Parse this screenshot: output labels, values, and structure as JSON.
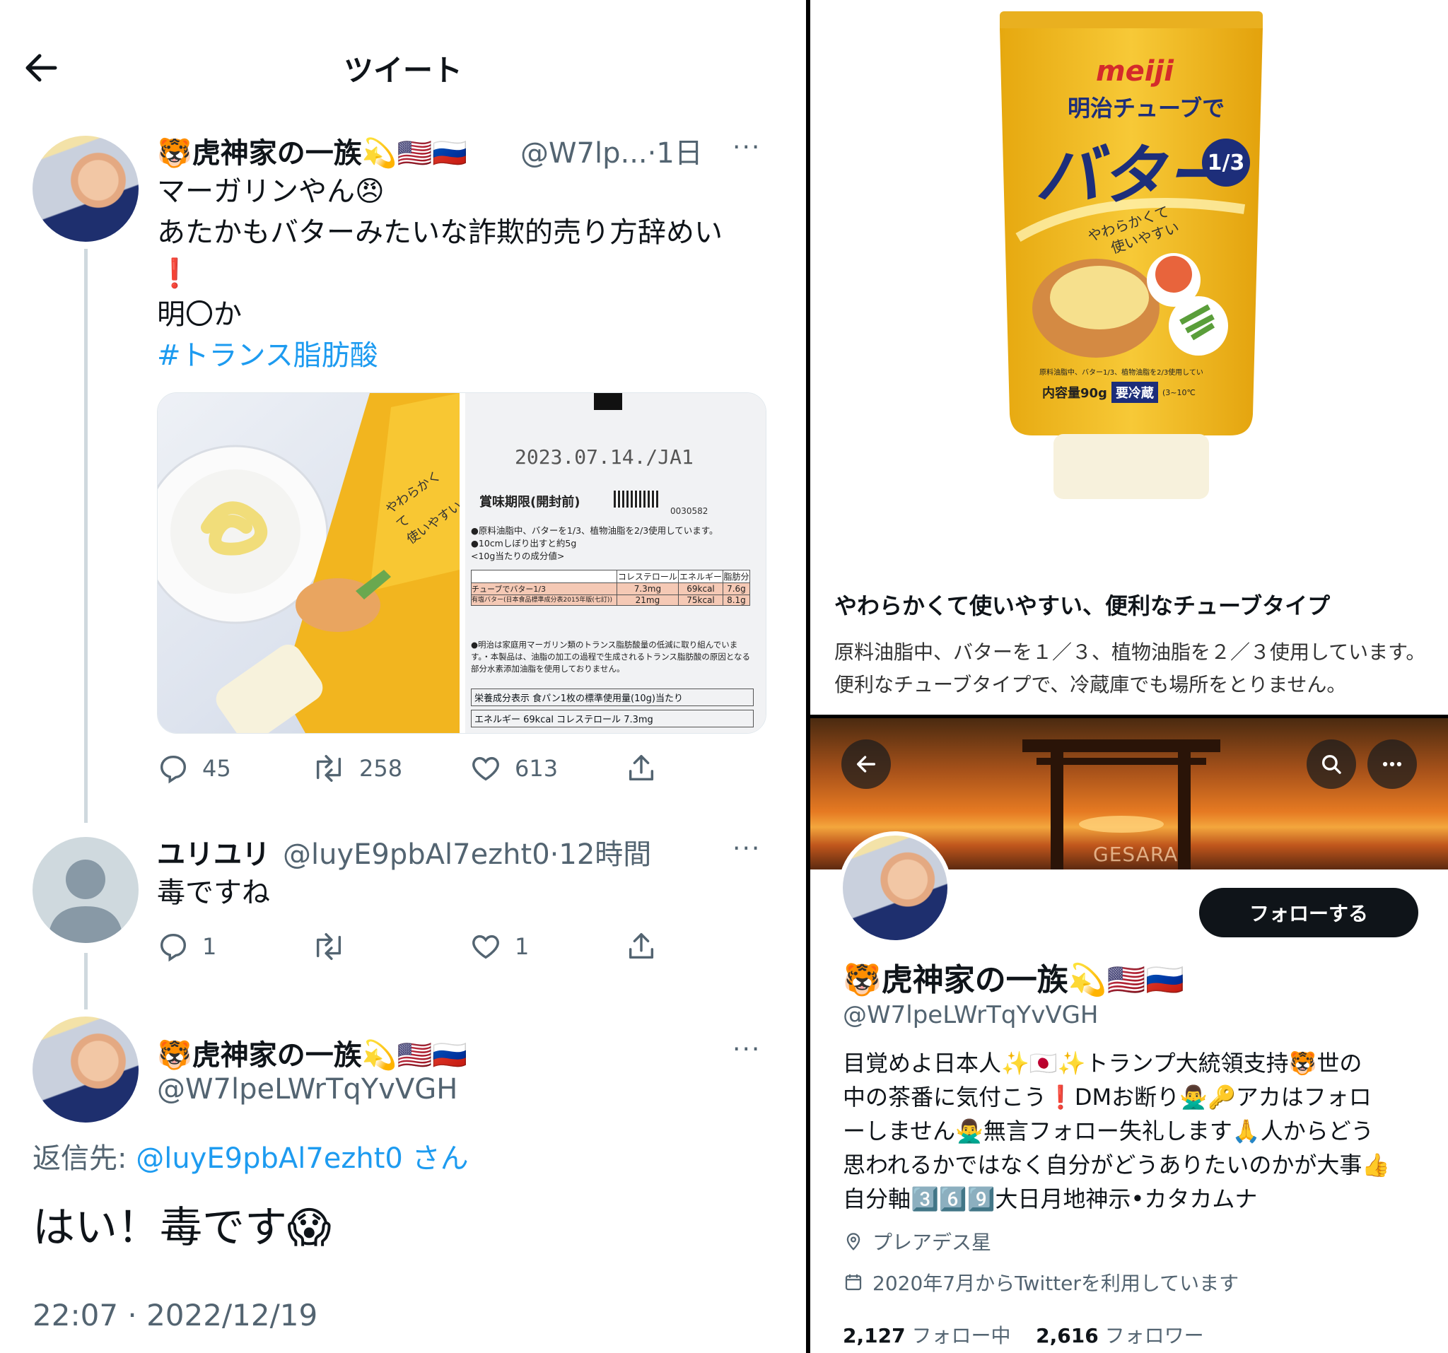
{
  "header": {
    "title": "ツイート"
  },
  "tweet1": {
    "name": "🐯虎神家の一族💫🇺🇸🇷🇺",
    "handle": "@W7lp...",
    "time": "·1日",
    "lines": [
      "マーガリンやん😠",
      "あたかもバターみたいな詐欺的売り方辞めい",
      "❗",
      "明〇か"
    ],
    "hashtag": "#トランス脂肪酸",
    "media_left_text": [
      "やわらかくて",
      "使いやすい"
    ],
    "media_right_text": {
      "date": "2023.07.14./JA1",
      "expiry": "賞味期限(開封前)",
      "code": "0030582",
      "line1": "●原料油脂中、バターを1/3、植物油脂を2/3使用しています。",
      "line2": "●10cmしぼり出すと約5g",
      "line3": "<10g当たりの成分値>",
      "table_headers": [
        "",
        "コレステロール",
        "エネルギー",
        "脂肪分"
      ],
      "table_rows": [
        [
          "チューブでバター1/3",
          "7.3mg",
          "69kcal",
          "7.6g"
        ],
        [
          "有塩バター(日本食品標準成分表2015年版(七訂))",
          "21mg",
          "75kcal",
          "8.1g"
        ]
      ],
      "line4": "●明治は家庭用マーガリン類のトランス脂肪酸量の低減に取り組んでいます。・本製品は、油脂の加工の過程で生成されるトランス脂肪酸の原因となる部分水素添加油脂を使用しておりません。",
      "line5": "栄養成分表示 食パン1枚の標準使用量(10g)当たり",
      "line6": "エネルギー 69kcal コレステロール 7.3mg"
    },
    "stats": {
      "replies": "45",
      "retweets": "258",
      "likes": "613"
    }
  },
  "tweet2": {
    "name": "ユリユリ",
    "handle": "@luyE9pbAl7ezht0",
    "time": "·12時間",
    "text": "毒ですね",
    "stats": {
      "replies": "1",
      "retweets": "",
      "likes": "1"
    }
  },
  "tweet3": {
    "name": "🐯虎神家の一族💫🇺🇸🇷🇺",
    "handle": "@W7lpeLWrTqYvVGH",
    "reply_prefix": "返信先: ",
    "reply_handle": "@luyE9pbAl7ezht0 さん",
    "text": "はい！毒です😱",
    "timestamp": "22:07 · 2022/12/19"
  },
  "product": {
    "brand": "meiji",
    "line1": "明治チューブで",
    "line2": "バター",
    "fraction": "1/3",
    "tagline": [
      "やわらかくて",
      "使いやすい"
    ],
    "small_note": "原料油脂中、バター1/3、植物油脂を2/3使用してい",
    "capacity": "内容量90g",
    "refrigerate": "要冷蔵",
    "temp": "(3~10℃",
    "heading": "やわらかくて使いやすい、便利なチューブタイプ",
    "description": "原料油脂中、バターを１／３、植物油脂を２／３使用しています。便利なチューブタイプで、冷蔵庫でも場所をとりません。"
  },
  "profile": {
    "banner_label": "GESARA",
    "follow_label": "フォローする",
    "name": "🐯虎神家の一族💫🇺🇸🇷🇺",
    "handle": "@W7lpeLWrTqYvVGH",
    "bio_lines": [
      "目覚めよ日本人✨🇯🇵✨トランプ大統領支持🐯世の",
      "中の茶番に気付こう❗DMお断り🙅‍♂️🔑アカはフォロ",
      "ーしません🙅‍♂️無言フォロー失礼します🙏人からどう",
      "思われるかではなく自分がどうありたいのかが大事👍",
      "自分軸3️⃣6️⃣9️⃣大日月地神示•カタカムナ"
    ],
    "location": "プレアデス星",
    "joined": "2020年7月からTwitterを利用しています",
    "following_count": "2,127",
    "following_label": "フォロー中",
    "followers_count": "2,616",
    "followers_label": "フォロワー"
  },
  "colors": {
    "link": "#1d9bf0",
    "muted": "#536471",
    "text": "#0f1419"
  }
}
